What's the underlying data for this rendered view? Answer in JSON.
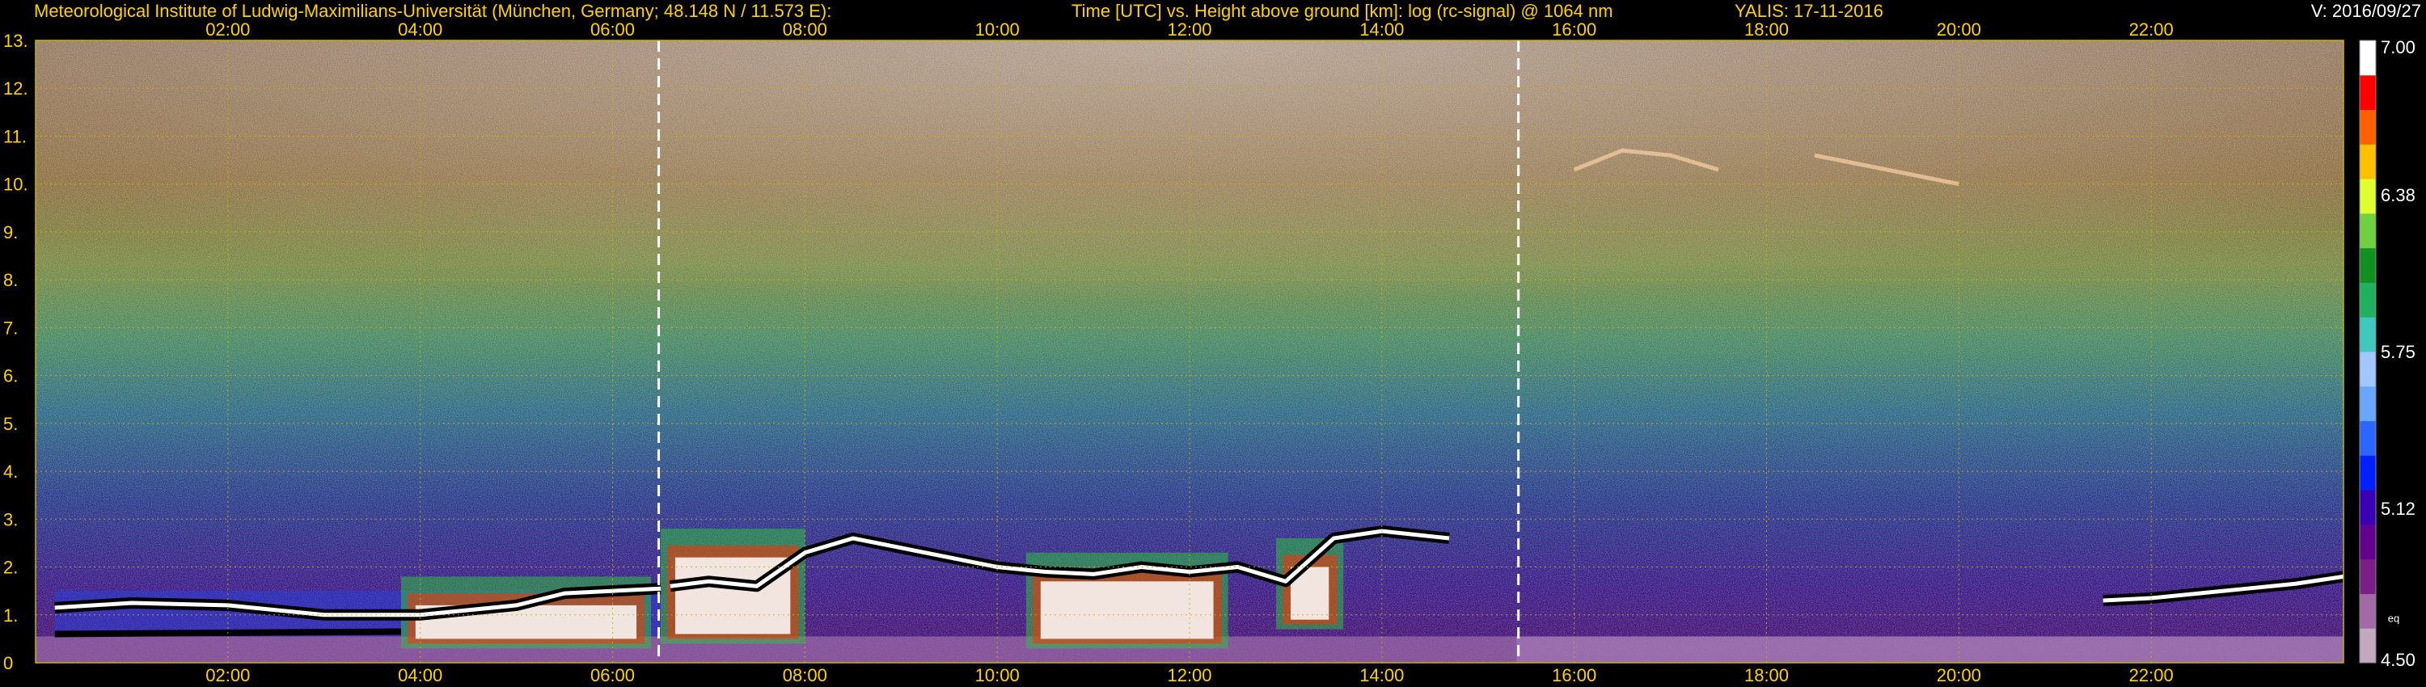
{
  "header": {
    "institute": "Meteorological Institute of Ludwig-Maximilians-Universität (München, Germany; 48.148 N / 11.573 E):",
    "description": "Time [UTC] vs. Height above ground [km]: log (rc-signal) @ 1064 nm",
    "system": "YALIS: 17-11-2016",
    "version": "V: 2016/09/27"
  },
  "chart_data": {
    "type": "heatmap",
    "title": "Time [UTC] vs. Height above ground [km]: log (rc-signal) @ 1064 nm",
    "xlabel": "Time [UTC]",
    "ylabel": "Height above ground [km]",
    "x_ticks": [
      "02:00",
      "04:00",
      "06:00",
      "08:00",
      "10:00",
      "12:00",
      "14:00",
      "16:00",
      "18:00",
      "20:00",
      "22:00"
    ],
    "x_tick_hours": [
      2,
      4,
      6,
      8,
      10,
      12,
      14,
      16,
      18,
      20,
      22
    ],
    "xlim_hours": [
      0,
      24
    ],
    "y_ticks": [
      "0",
      "1.",
      "2.",
      "3.",
      "4.",
      "5.",
      "6.",
      "7.",
      "8.",
      "9.",
      "10.",
      "11.",
      "12.",
      "13."
    ],
    "ylim_km": [
      0,
      13
    ],
    "grid": true,
    "colorbar": {
      "range": [
        4.5,
        7.0
      ],
      "ticks": [
        "7.00",
        "6.38",
        "5.75",
        "5.12",
        "4.50"
      ],
      "tick_values": [
        7.0,
        6.38,
        5.75,
        5.12,
        4.5
      ],
      "unit_label": "eq",
      "colors": [
        "#c4a8c0",
        "#a46aa6",
        "#7a1f86",
        "#63008f",
        "#3a00b4",
        "#0020ff",
        "#2a66ff",
        "#6aa6ff",
        "#a0c8ff",
        "#40c8c0",
        "#20b060",
        "#109020",
        "#70d040",
        "#e0ff30",
        "#ffc000",
        "#ff6000",
        "#ff0000",
        "#ffffff"
      ]
    },
    "markers_hours": [
      6.48,
      15.42
    ],
    "cloud_layers": [
      {
        "t": [
          0.2,
          1.0,
          2.0,
          3.0,
          4.0,
          5.0,
          5.5,
          6.5
        ],
        "h": [
          1.15,
          1.25,
          1.2,
          1.0,
          1.0,
          1.2,
          1.45,
          1.55
        ]
      },
      {
        "t": [
          6.6,
          7.0,
          7.5,
          8.0,
          8.5,
          9.0,
          9.5,
          10.0,
          10.5,
          11.0,
          11.5,
          12.0,
          12.5,
          13.0,
          13.5,
          14.0,
          14.7
        ],
        "h": [
          1.6,
          1.7,
          1.6,
          2.3,
          2.6,
          2.4,
          2.2,
          2.0,
          1.9,
          1.85,
          2.0,
          1.9,
          2.0,
          1.7,
          2.6,
          2.75,
          2.6
        ]
      },
      {
        "t": [
          21.5,
          22.0,
          22.5,
          23.0,
          23.5,
          24.0
        ],
        "h": [
          1.3,
          1.35,
          1.45,
          1.55,
          1.65,
          1.8
        ]
      }
    ],
    "cirrus": [
      {
        "t": [
          16.0,
          16.5,
          17.0,
          17.5
        ],
        "h": [
          10.3,
          10.7,
          10.6,
          10.3
        ]
      },
      {
        "t": [
          18.5,
          19.0,
          19.5,
          20.0
        ],
        "h": [
          10.6,
          10.4,
          10.2,
          10.0
        ]
      }
    ]
  }
}
